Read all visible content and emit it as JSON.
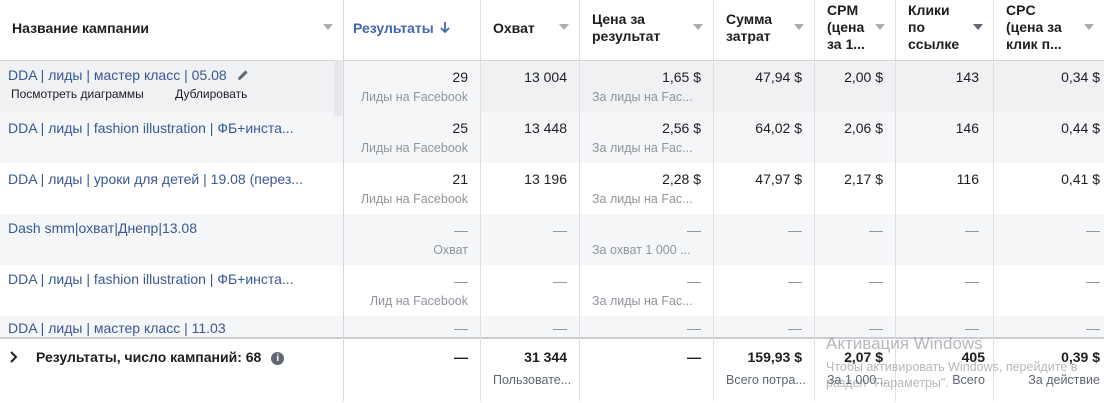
{
  "columns": {
    "name": "Название кампании",
    "results": "Результаты",
    "reach": "Охват",
    "cost_per_result": [
      "Цена за",
      "результат"
    ],
    "spend": [
      "Сумма",
      "затрат"
    ],
    "cpm": [
      "CPM",
      "(цена",
      "за 1..."
    ],
    "clicks": [
      "Клики",
      "по",
      "ссылке"
    ],
    "cpc": [
      "CPC",
      "(цена за",
      "клик п..."
    ]
  },
  "row_actions": {
    "view_charts": "Посмотреть диаграммы",
    "duplicate": "Дублировать"
  },
  "rows": [
    {
      "name": "DDA | лиды | мастер класс | 05.08",
      "results": "29",
      "results_type": "Лиды на Facebook",
      "reach": "13 004",
      "cost": "1,65 $",
      "cost_type": "За лиды на Fac...",
      "spend": "47,94 $",
      "cpm": "2,00 $",
      "clicks": "143",
      "cpc": "0,34 $"
    },
    {
      "name": "DDA | лиды | fashion illustration | ФБ+инста...",
      "results": "25",
      "results_type": "Лиды на Facebook",
      "reach": "13 448",
      "cost": "2,56 $",
      "cost_type": "За лиды на Fac...",
      "spend": "64,02 $",
      "cpm": "2,06 $",
      "clicks": "146",
      "cpc": "0,44 $"
    },
    {
      "name": "DDA | лиды | уроки для детей | 19.08 (перез...",
      "results": "21",
      "results_type": "Лиды на Facebook",
      "reach": "13 196",
      "cost": "2,28 $",
      "cost_type": "За лиды на Fac...",
      "spend": "47,97 $",
      "cpm": "2,17 $",
      "clicks": "116",
      "cpc": "0,41 $"
    },
    {
      "name": "Dash smm|охват|Днепр|13.08",
      "results": "—",
      "results_type": "Охват",
      "reach": "—",
      "cost": "—",
      "cost_type": "За охват 1 000 ...",
      "spend": "—",
      "cpm": "—",
      "clicks": "—",
      "cpc": "—"
    },
    {
      "name": "DDA | лиды | fashion illustration | ФБ+инста...",
      "results": "—",
      "results_type": "Лид на Facebook",
      "reach": "—",
      "cost": "—",
      "cost_type": "За лиды на Fac...",
      "spend": "—",
      "cpm": "—",
      "clicks": "—",
      "cpc": "—"
    },
    {
      "name": "DDA | лиды | мастер класс | 11.03",
      "results": "—",
      "results_type": "",
      "reach": "—",
      "cost": "—",
      "cost_type": "",
      "spend": "—",
      "cpm": "—",
      "clicks": "—",
      "cpc": "—"
    }
  ],
  "footer": {
    "label": "Результаты, число кампаний: 68",
    "results": "—",
    "reach": "31 344",
    "reach_sub": "Пользовате...",
    "cost": "—",
    "spend": "159,93 $",
    "spend_sub": "Всего потра...",
    "cpm": "2,07 $",
    "cpm_sub": "За 1 000...",
    "clicks": "405",
    "clicks_sub": "Всего",
    "cpc": "0,39 $",
    "cpc_sub": "За действие"
  },
  "watermark": {
    "title": "Активация Windows",
    "line1": "Чтобы активировать Windows, перейдите в",
    "line2": "раздел \"Параметры\"."
  },
  "colors": {
    "link": "#385898",
    "sorted_header": "#4267b2",
    "muted": "#90949c"
  }
}
